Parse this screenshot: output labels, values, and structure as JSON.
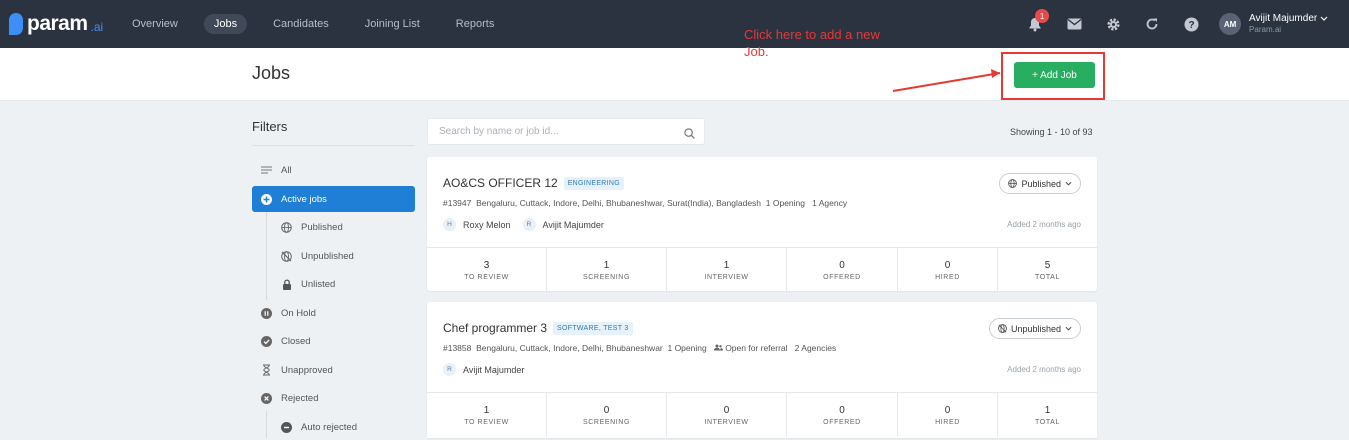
{
  "brand": {
    "name": "param",
    "suffix": ".ai"
  },
  "nav": {
    "links": [
      "Overview",
      "Jobs",
      "Candidates",
      "Joining List",
      "Reports"
    ],
    "notification_count": "1",
    "user": {
      "initials": "AM",
      "name": "Avijit Majumder",
      "org": "Param.ai"
    }
  },
  "header": {
    "title": "Jobs",
    "add_job_label": "+ Add Job"
  },
  "annotation": {
    "text": "Click here to add a new Job.",
    "color": "#e53935"
  },
  "filters": {
    "title": "Filters",
    "items": [
      "All",
      "Active jobs",
      "Published",
      "Unpublished",
      "Unlisted",
      "On Hold",
      "Closed",
      "Unapproved",
      "Rejected",
      "Auto rejected"
    ]
  },
  "search": {
    "placeholder": "Search by name or job id..."
  },
  "showing": "Showing 1 - 10 of 93",
  "stat_labels": [
    "TO REVIEW",
    "SCREENING",
    "INTERVIEW",
    "OFFERED",
    "HIRED",
    "TOTAL"
  ],
  "jobs": [
    {
      "title": "AO&CS OFFICER 12",
      "tag": "ENGINEERING",
      "id": "#13947",
      "locations": "Bengaluru, Cuttack, Indore, Delhi, Bhubaneshwar, Surat(India), Bangladesh",
      "openings": "1 Opening",
      "agency": "1  Agency",
      "people": [
        {
          "chip": "H",
          "name": "Roxy Melon"
        },
        {
          "chip": "R",
          "name": "Avijit Majumder"
        }
      ],
      "status": "Published",
      "added": "Added 2 months ago",
      "stats": [
        "3",
        "1",
        "1",
        "0",
        "0",
        "5"
      ]
    },
    {
      "title": "Chef programmer 3",
      "tag": "SOFTWARE, TEST 3",
      "id": "#13858",
      "locations": "Bengaluru, Cuttack, Indore, Delhi, Bhubaneshwar",
      "openings": "1 Opening",
      "referral": "Open for referral",
      "agency": "2  Agencies",
      "people": [
        {
          "chip": "R",
          "name": "Avijit Majumder"
        }
      ],
      "status": "Unpublished",
      "added": "Added 2 months ago",
      "stats": [
        "1",
        "0",
        "0",
        "0",
        "0",
        "1"
      ]
    }
  ],
  "colors": {
    "nav_bg": "#2b3340",
    "accent_blue": "#1f7ed6",
    "add_job_green": "#27ae60",
    "annotation_red": "#e53935"
  }
}
